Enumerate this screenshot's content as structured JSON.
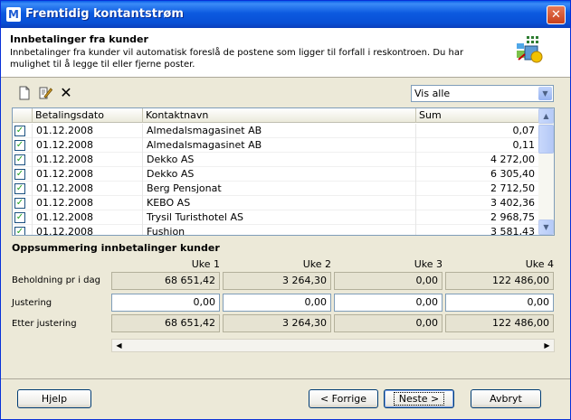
{
  "window": {
    "title": "Fremtidig kontantstrøm",
    "app_icon_letter": "M",
    "close_label": "✕"
  },
  "header": {
    "title": "Innbetalinger fra kunder",
    "description": "Innbetalinger fra kunder vil automatisk foreslå de postene som ligger til forfall i reskontroen. Du har mulighet til å legge til eller fjerne poster."
  },
  "toolbar": {
    "new_icon": "new-document-icon",
    "edit_icon": "edit-icon",
    "delete_icon": "delete-icon",
    "delete_glyph": "✕"
  },
  "filter": {
    "selected": "Vis alle"
  },
  "grid": {
    "columns": [
      "Betalingsdato",
      "Kontaktnavn",
      "Sum"
    ],
    "rows": [
      {
        "date": "01.12.2008",
        "name": "Almedalsmagasinet AB",
        "sum": "0,07"
      },
      {
        "date": "01.12.2008",
        "name": "Almedalsmagasinet AB",
        "sum": "0,11"
      },
      {
        "date": "01.12.2008",
        "name": "Dekko AS",
        "sum": "4 272,00"
      },
      {
        "date": "01.12.2008",
        "name": "Dekko AS",
        "sum": "6 305,40"
      },
      {
        "date": "01.12.2008",
        "name": "Berg Pensjonat",
        "sum": "2 712,50"
      },
      {
        "date": "01.12.2008",
        "name": "KEBO AS",
        "sum": "3 402,36"
      },
      {
        "date": "01.12.2008",
        "name": "Trysil Turisthotel AS",
        "sum": "2 968,75"
      },
      {
        "date": "01.12.2008",
        "name": "Fushion",
        "sum": "3 581,43"
      }
    ]
  },
  "summary": {
    "title": "Oppsummering innbetalinger kunder",
    "weeks": [
      "Uke 1",
      "Uke 2",
      "Uke 3",
      "Uke 4"
    ],
    "labels": {
      "holding": "Beholdning pr i dag",
      "adjustment": "Justering",
      "after": "Etter justering"
    },
    "holding": [
      "68 651,42",
      "3 264,30",
      "0,00",
      "122 486,00"
    ],
    "adjustment": [
      "0,00",
      "0,00",
      "0,00",
      "0,00"
    ],
    "after": [
      "68 651,42",
      "3 264,30",
      "0,00",
      "122 486,00"
    ]
  },
  "buttons": {
    "help": "Hjelp",
    "back": "< Forrige",
    "next": "Neste >",
    "cancel": "Avbryt"
  }
}
